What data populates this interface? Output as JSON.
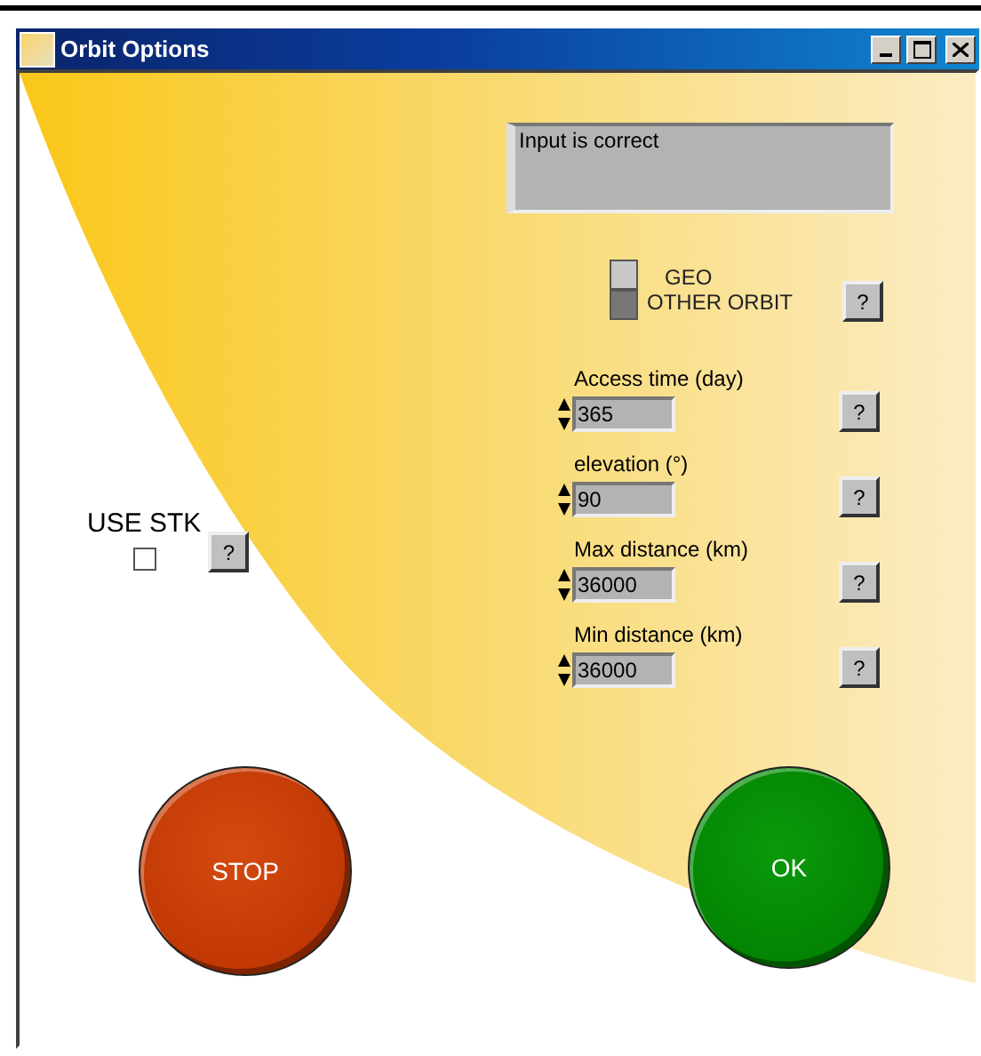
{
  "window": {
    "title": "Orbit Options"
  },
  "status": {
    "message": "Input is correct"
  },
  "orbit_switch": {
    "help": "?",
    "options": [
      {
        "label": "GEO",
        "selected": true
      },
      {
        "label": "OTHER ORBIT",
        "selected": false
      }
    ]
  },
  "use_stk": {
    "label": "USE STK",
    "checked": false,
    "help": "?"
  },
  "fields": [
    {
      "label": "Access time (day)",
      "value": "365",
      "help": "?"
    },
    {
      "label": "elevation (°)",
      "value": "90",
      "help": "?"
    },
    {
      "label": "Max distance (km)",
      "value": "36000",
      "help": "?"
    },
    {
      "label": "Min distance (km)",
      "value": "36000",
      "help": "?"
    }
  ],
  "buttons": [
    {
      "label": "STOP",
      "kind": "stop"
    },
    {
      "label": "OK",
      "kind": "ok"
    }
  ]
}
